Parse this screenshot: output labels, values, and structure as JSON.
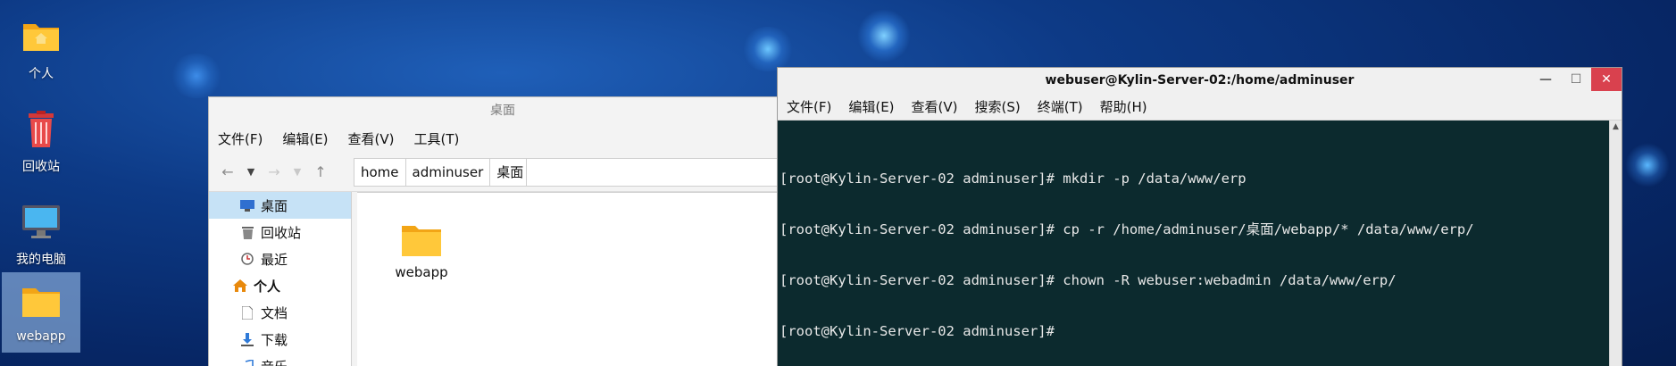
{
  "desktop": {
    "icons": [
      {
        "label": "个人"
      },
      {
        "label": "回收站"
      },
      {
        "label": "我的电脑"
      },
      {
        "label": "webapp"
      }
    ]
  },
  "file_manager": {
    "title": "桌面",
    "menu": [
      "文件(F)",
      "编辑(E)",
      "查看(V)",
      "工具(T)"
    ],
    "breadcrumbs": [
      "home",
      "adminuser",
      "桌面"
    ],
    "sidebar": [
      {
        "label": "桌面",
        "icon": "desktop-icon",
        "active": true
      },
      {
        "label": "回收站",
        "icon": "trash-icon"
      },
      {
        "label": "最近",
        "icon": "clock-icon"
      },
      {
        "label": "个人",
        "icon": "home-icon",
        "head": true
      },
      {
        "label": "文档",
        "icon": "document-icon"
      },
      {
        "label": "下载",
        "icon": "download-icon"
      },
      {
        "label": "音乐",
        "icon": "music-icon"
      }
    ],
    "files": [
      {
        "name": "webapp",
        "icon": "folder-icon"
      }
    ]
  },
  "terminal": {
    "title": "webuser@Kylin-Server-02:/home/adminuser",
    "menu": [
      "文件(F)",
      "编辑(E)",
      "查看(V)",
      "搜索(S)",
      "终端(T)",
      "帮助(H)"
    ],
    "lines": [
      "[root@Kylin-Server-02 adminuser]# mkdir -p /data/www/erp",
      "[root@Kylin-Server-02 adminuser]# cp -r /home/adminuser/桌面/webapp/* /data/www/erp/",
      "[root@Kylin-Server-02 adminuser]# chown -R webuser:webadmin /data/www/erp/",
      "[root@Kylin-Server-02 adminuser]#"
    ]
  },
  "colors": {
    "terminal_bg": "#0c2a2e",
    "close_button": "#d9414e",
    "sidebar_active": "#c6e2f6",
    "folder": "#f6b21b"
  }
}
